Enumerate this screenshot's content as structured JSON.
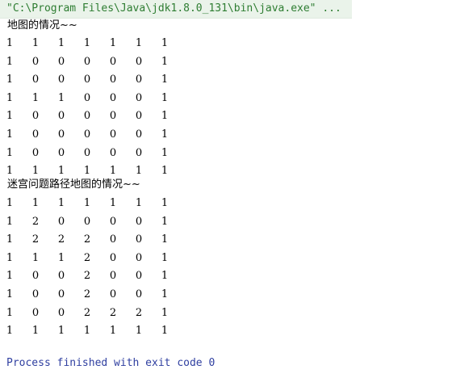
{
  "console": {
    "command": "\"C:\\Program Files\\Java\\jdk1.8.0_131\\bin\\java.exe\" ...",
    "map_label": "地图的情况~~",
    "map_rows": [
      [
        "1",
        "1",
        "1",
        "1",
        "1",
        "1",
        "1"
      ],
      [
        "1",
        "0",
        "0",
        "0",
        "0",
        "0",
        "1"
      ],
      [
        "1",
        "0",
        "0",
        "0",
        "0",
        "0",
        "1"
      ],
      [
        "1",
        "1",
        "1",
        "0",
        "0",
        "0",
        "1"
      ],
      [
        "1",
        "0",
        "0",
        "0",
        "0",
        "0",
        "1"
      ],
      [
        "1",
        "0",
        "0",
        "0",
        "0",
        "0",
        "1"
      ],
      [
        "1",
        "0",
        "0",
        "0",
        "0",
        "0",
        "1"
      ],
      [
        "1",
        "1",
        "1",
        "1",
        "1",
        "1",
        "1"
      ]
    ],
    "path_label": "迷宫问题路径地图的情况~~",
    "path_rows": [
      [
        "1",
        "1",
        "1",
        "1",
        "1",
        "1",
        "1"
      ],
      [
        "1",
        "2",
        "0",
        "0",
        "0",
        "0",
        "1"
      ],
      [
        "1",
        "2",
        "2",
        "2",
        "0",
        "0",
        "1"
      ],
      [
        "1",
        "1",
        "1",
        "2",
        "0",
        "0",
        "1"
      ],
      [
        "1",
        "0",
        "0",
        "2",
        "0",
        "0",
        "1"
      ],
      [
        "1",
        "0",
        "0",
        "2",
        "0",
        "0",
        "1"
      ],
      [
        "1",
        "0",
        "0",
        "2",
        "2",
        "2",
        "1"
      ],
      [
        "1",
        "1",
        "1",
        "1",
        "1",
        "1",
        "1"
      ]
    ],
    "exit_message": "Process finished with exit code 0"
  },
  "colors": {
    "command_text": "#2e7d32",
    "command_background": "#eaf3ea",
    "exit_text": "#2f3fa0"
  }
}
